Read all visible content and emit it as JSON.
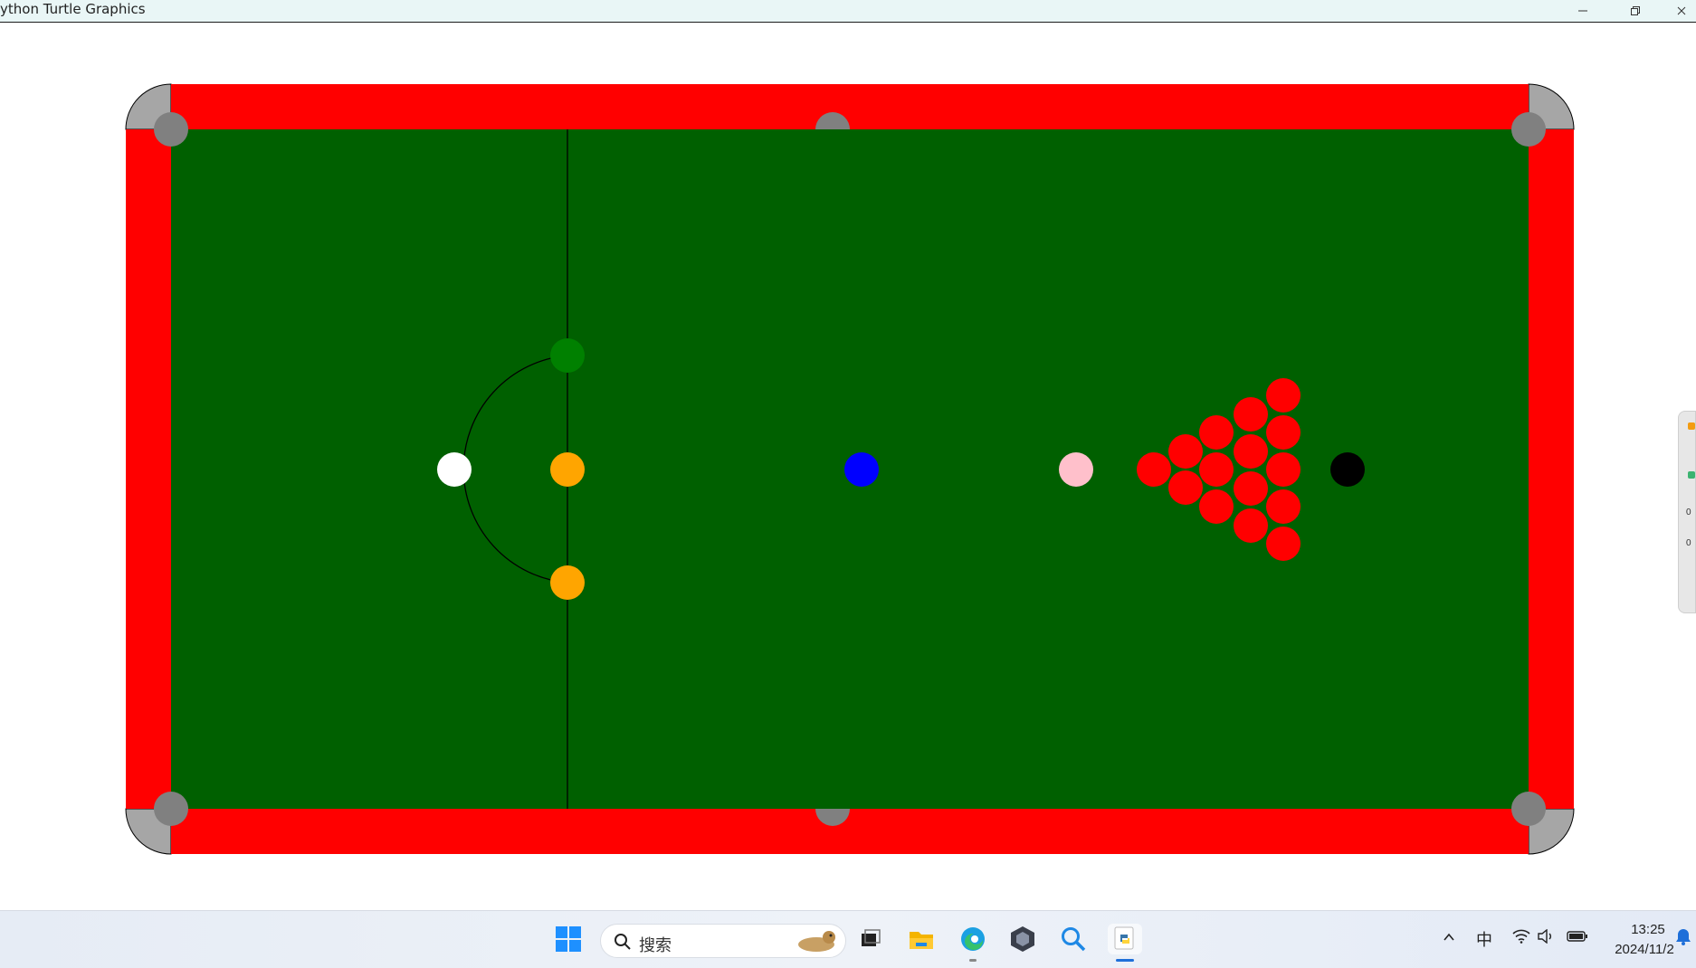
{
  "window": {
    "title": "ython Turtle Graphics",
    "minimize_icon": "minimize-icon",
    "restore_icon": "restore-icon",
    "close_icon": "close-icon"
  },
  "table": {
    "cushion_color": "#ff0000",
    "cloth_color": "#006000",
    "pocket_color": "#808080",
    "corner_color": "#a6a6a6",
    "line_color": "#000000",
    "balls": [
      {
        "name": "cue-ball",
        "color": "#ffffff"
      },
      {
        "name": "green-ball",
        "color": "#008000"
      },
      {
        "name": "yellow-ball",
        "color": "#ffa500"
      },
      {
        "name": "brown-ball",
        "color": "#ffa500"
      },
      {
        "name": "blue-ball",
        "color": "#0000ff"
      },
      {
        "name": "pink-ball",
        "color": "#ffc0cb"
      },
      {
        "name": "black-ball",
        "color": "#000000"
      }
    ],
    "red_ball_count": 15,
    "red_color": "#ff0000"
  },
  "side_widget": {
    "upload_value": "0",
    "download_value": "0"
  },
  "taskbar": {
    "search_placeholder": "搜索",
    "ime_indicator": "中",
    "clock_time": "13:25",
    "clock_date": "2024/11/2",
    "icons": [
      "windows-start-icon",
      "search-icon",
      "task-view-icon",
      "file-explorer-icon",
      "edge-browser-icon",
      "app-icon",
      "magnifier-icon",
      "python-icon"
    ]
  }
}
